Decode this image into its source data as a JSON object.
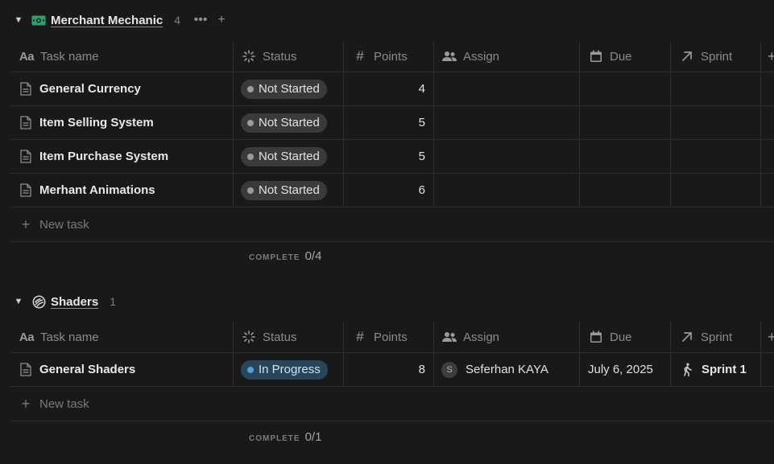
{
  "columns": {
    "task_name": "Task name",
    "status": "Status",
    "points": "Points",
    "assign": "Assign",
    "due": "Due",
    "sprint": "Sprint",
    "add": "+"
  },
  "groups": [
    {
      "title": "Merchant Mechanic",
      "count": "4",
      "summary_label": "COMPLETE",
      "summary_value": "0/4",
      "new_task_label": "New task",
      "rows": [
        {
          "name": "General Currency",
          "status": "Not Started",
          "points": "4"
        },
        {
          "name": "Item Selling System",
          "status": "Not Started",
          "points": "5"
        },
        {
          "name": "Item Purchase System",
          "status": "Not Started",
          "points": "5"
        },
        {
          "name": "Merhant Animations",
          "status": "Not Started",
          "points": "6"
        }
      ]
    },
    {
      "title": "Shaders",
      "count": "1",
      "summary_label": "COMPLETE",
      "summary_value": "0/1",
      "new_task_label": "New task",
      "rows": [
        {
          "name": "General Shaders",
          "status": "In Progress",
          "points": "8",
          "avatar_initial": "S",
          "assignee": "Seferhan KAYA",
          "due": "July 6, 2025",
          "sprint": "Sprint 1"
        }
      ]
    }
  ],
  "icons": {
    "group1": "money-icon",
    "group2": "swirl-icon",
    "task": "document-icon",
    "sprint": "walking-person-icon"
  },
  "colors": {
    "background": "#191919",
    "not_started_pill": "#3a3a3a",
    "in_progress_pill": "#28455a",
    "in_progress_dot": "#4ea1d8",
    "money_icon": "#2e9e6a"
  }
}
